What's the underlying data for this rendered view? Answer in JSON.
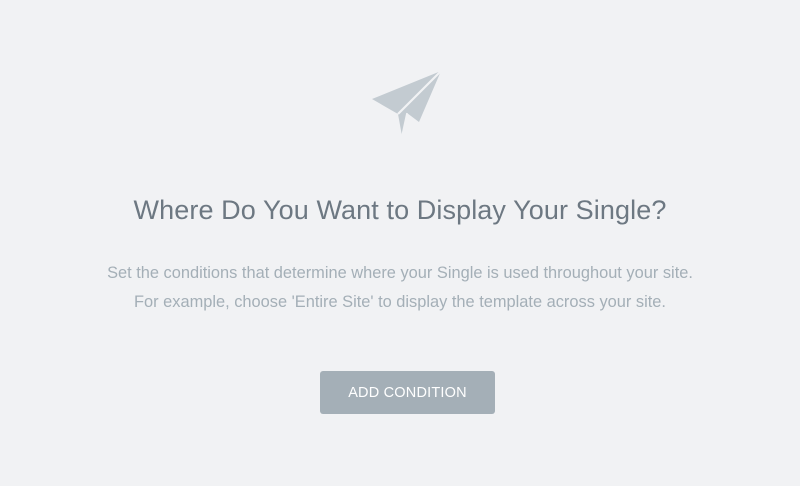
{
  "empty_state": {
    "icon": "paper-plane-icon",
    "title": "Where Do You Want to Display Your Single?",
    "description_line_1": "Set the conditions that determine where your Single is used throughout your site.",
    "description_line_2": "For example, choose 'Entire Site' to display the template across your site.",
    "button_label": "ADD CONDITION"
  },
  "colors": {
    "background": "#f1f2f4",
    "icon": "#c3cbd1",
    "title": "#6d7882",
    "description": "#a4afb7",
    "button_bg": "#a4afb7",
    "button_text": "#ffffff"
  }
}
